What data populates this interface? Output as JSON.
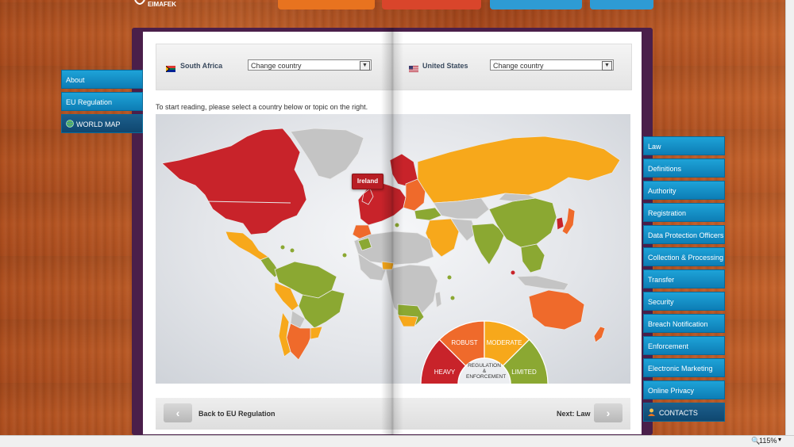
{
  "app": {
    "logo_text": "EIMAFEK"
  },
  "top_bar": {
    "colors": [
      "#e8731f",
      "#d9452b",
      "#2e9bd4",
      "#2e9bd4"
    ]
  },
  "left_nav": {
    "items": [
      {
        "label": "About",
        "icon": null
      },
      {
        "label": "EU Regulation",
        "icon": null
      },
      {
        "label": "WORLD MAP",
        "icon": "globe-icon",
        "active": true
      }
    ]
  },
  "country_bar": {
    "left": {
      "country": "South Africa",
      "select_value": "Change country",
      "flag": "south-africa-flag-icon"
    },
    "right": {
      "country": "United States",
      "select_value": "Change country",
      "flag": "us-flag-icon"
    }
  },
  "intro_text": "To start reading, please select a country below or topic on the right.",
  "map": {
    "tooltip": "Ireland",
    "legend": {
      "center_label": "REGULATION & ENFORCEMENT",
      "segments": [
        {
          "label": "HEAVY",
          "color": "#c8232a"
        },
        {
          "label": "ROBUST",
          "color": "#ef6a2b"
        },
        {
          "label": "MODERATE",
          "color": "#f7a81b"
        },
        {
          "label": "LIMITED",
          "color": "#8ba832"
        }
      ]
    }
  },
  "footer_nav": {
    "back_label": "Back to EU Regulation",
    "next_label": "Next: Law"
  },
  "right_nav": {
    "items": [
      {
        "label": "Law"
      },
      {
        "label": "Definitions"
      },
      {
        "label": "Authority"
      },
      {
        "label": "Registration"
      },
      {
        "label": "Data Protection Officers"
      },
      {
        "label": "Collection & Processing"
      },
      {
        "label": "Transfer"
      },
      {
        "label": "Security"
      },
      {
        "label": "Breach Notification"
      },
      {
        "label": "Enforcement"
      },
      {
        "label": "Electronic Marketing"
      },
      {
        "label": "Online Privacy"
      },
      {
        "label": "CONTACTS",
        "icon": "person-icon",
        "active": true
      }
    ]
  },
  "status_bar": {
    "zoom": "115%"
  }
}
